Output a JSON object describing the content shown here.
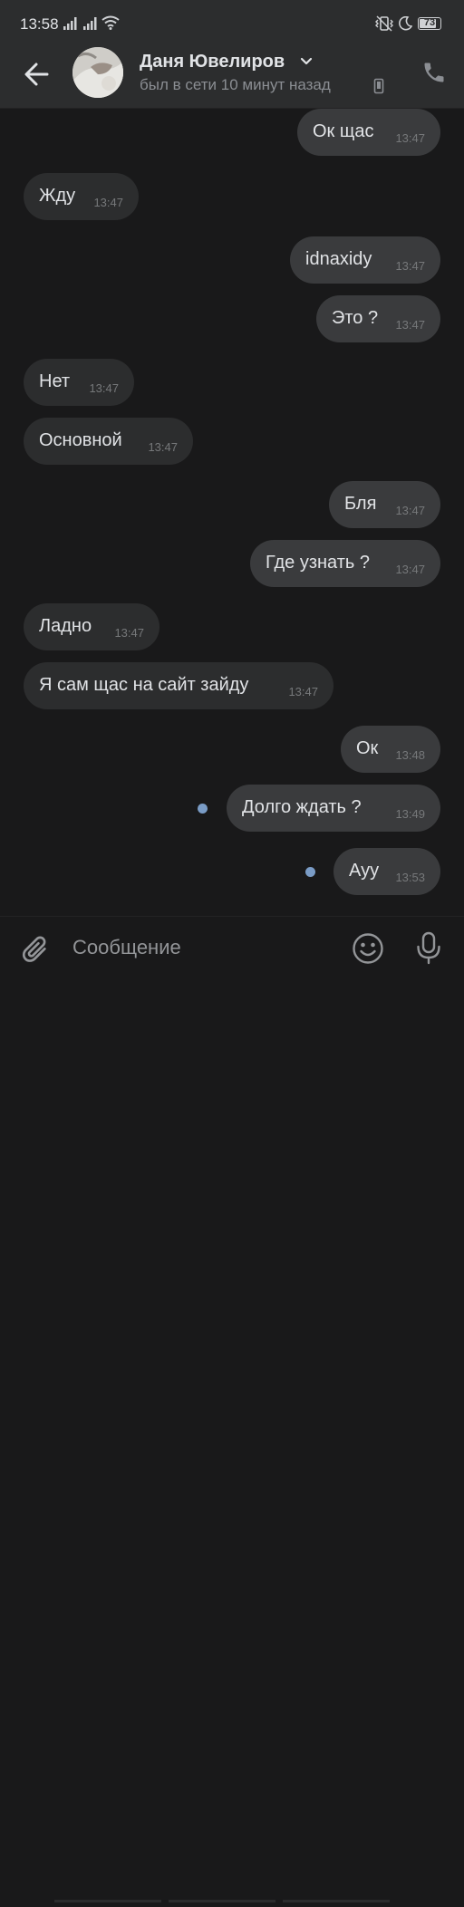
{
  "status_bar": {
    "time": "13:58",
    "battery": "73",
    "battery_level": 0.73,
    "icons": [
      "signal-icon",
      "signal-icon",
      "wifi-icon",
      "vibrate-icon",
      "do-not-disturb-icon",
      "battery-icon"
    ]
  },
  "header": {
    "contact_name": "Даня Ювелиров",
    "status": "был в сети 10 минут назад",
    "icons": [
      "back-arrow-icon",
      "chevron-down-icon",
      "mobile-phone-icon",
      "phone-call-icon"
    ]
  },
  "messages": [
    {
      "text": "Ок щас",
      "time": "13:47",
      "dir": "out"
    },
    {
      "text": "Жду",
      "time": "13:47",
      "dir": "in"
    },
    {
      "text": "idnaxidy",
      "time": "13:47",
      "dir": "out"
    },
    {
      "text": "Это ?",
      "time": "13:47",
      "dir": "out"
    },
    {
      "text": "Нет",
      "time": "13:47",
      "dir": "in"
    },
    {
      "text": "Основной",
      "time": "13:47",
      "dir": "in"
    },
    {
      "text": "Бля",
      "time": "13:47",
      "dir": "out"
    },
    {
      "text": "Где узнать ?",
      "time": "13:47",
      "dir": "out"
    },
    {
      "text": "Ладно",
      "time": "13:47",
      "dir": "in"
    },
    {
      "text": "Я сам щас на сайт зайду",
      "time": "13:47",
      "dir": "in"
    },
    {
      "text": "Ок",
      "time": "13:48",
      "dir": "out"
    },
    {
      "text": "Долго ждать ?",
      "time": "13:49",
      "dir": "out",
      "unread": true
    },
    {
      "text": "Ауу",
      "time": "13:53",
      "dir": "out",
      "unread": true
    }
  ],
  "composer": {
    "placeholder": "Сообщение",
    "icons": [
      "paperclip-icon",
      "emoji-icon",
      "microphone-icon"
    ]
  },
  "colors": {
    "background": "#19191a",
    "bar": "#2c2d2e",
    "bubble_in": "#2c2d2e",
    "bubble_out": "#3a3b3d",
    "text": "#e1e3e6",
    "secondary": "#8b8e93",
    "unread_dot": "#7a9cc6"
  }
}
